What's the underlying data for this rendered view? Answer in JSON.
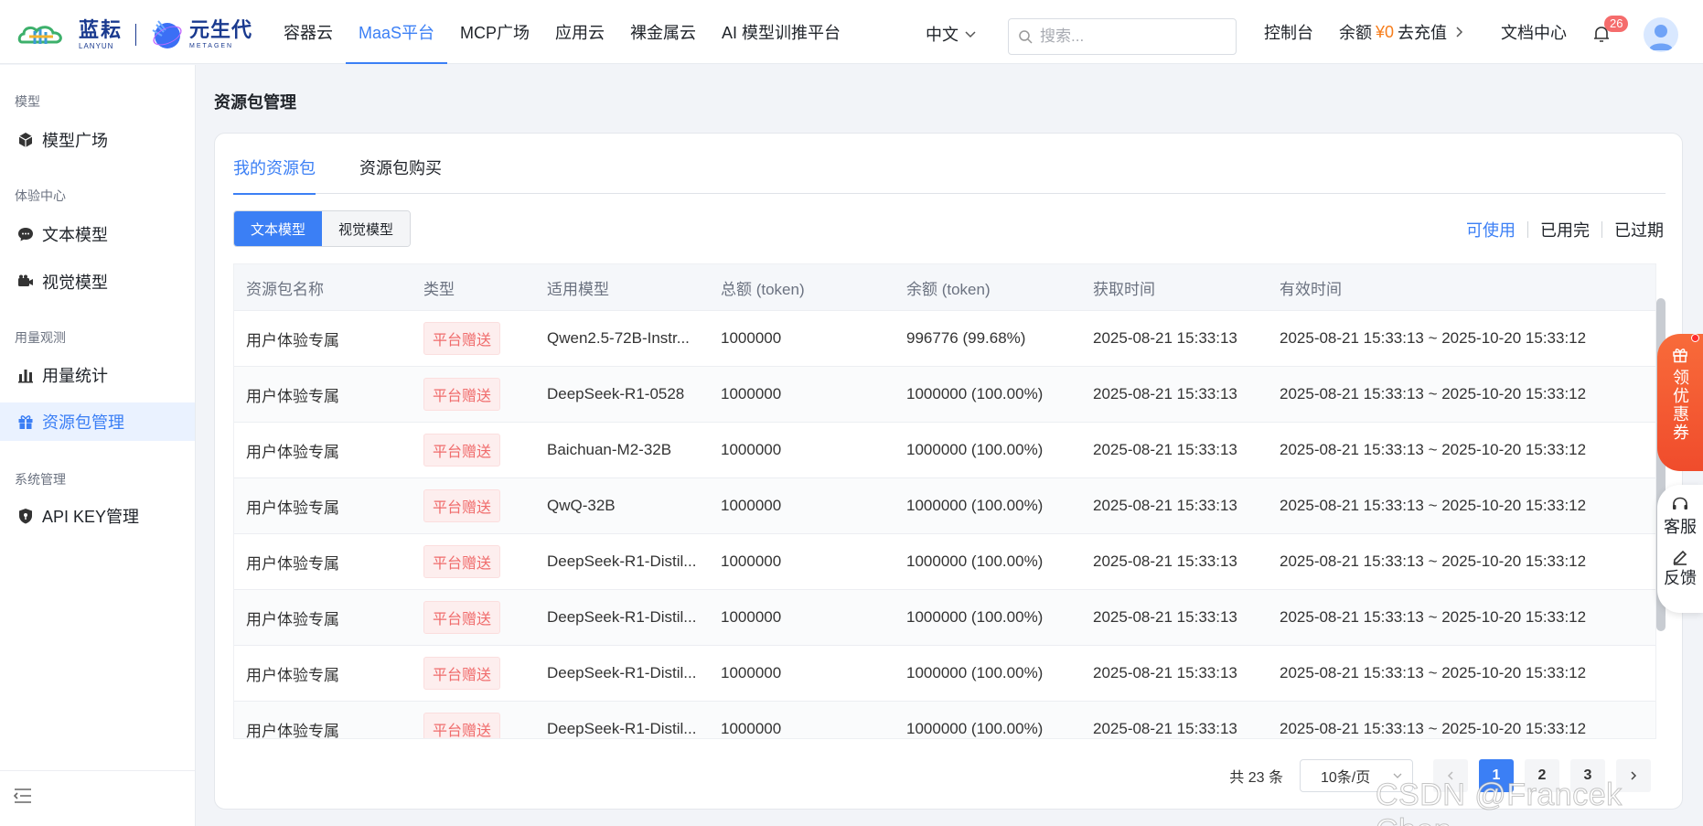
{
  "brand": {
    "logo1_cn": "蓝耘",
    "logo1_en": "LANYUN",
    "logo2_cn": "元生代",
    "logo2_en": "METAGEN"
  },
  "nav": {
    "items": [
      {
        "label": "容器云"
      },
      {
        "label": "MaaS平台",
        "active": true
      },
      {
        "label": "MCP广场"
      },
      {
        "label": "应用云"
      },
      {
        "label": "裸金属云"
      },
      {
        "label": "AI 模型训推平台"
      }
    ],
    "lang": "中文",
    "search_placeholder": "搜索...",
    "console": "控制台",
    "balance_label": "余额",
    "balance_amount": "¥0",
    "recharge": "去充值",
    "docs": "文档中心",
    "notifications": "26"
  },
  "sidebar": {
    "groups": [
      {
        "title": "模型",
        "items": [
          {
            "label": "模型广场",
            "icon": "cube-icon"
          }
        ]
      },
      {
        "title": "体验中心",
        "items": [
          {
            "label": "文本模型",
            "icon": "chat-bubble-icon"
          },
          {
            "label": "视觉模型",
            "icon": "camera-icon"
          }
        ]
      },
      {
        "title": "用量观测",
        "items": [
          {
            "label": "用量统计",
            "icon": "bar-chart-icon"
          },
          {
            "label": "资源包管理",
            "icon": "gift-icon",
            "active": true
          }
        ]
      },
      {
        "title": "系统管理",
        "items": [
          {
            "label": "API KEY管理",
            "icon": "shield-icon"
          }
        ]
      }
    ]
  },
  "page": {
    "title": "资源包管理",
    "tabs": [
      {
        "label": "我的资源包",
        "active": true
      },
      {
        "label": "资源包购买"
      }
    ],
    "segments": [
      {
        "label": "文本模型",
        "active": true
      },
      {
        "label": "视觉模型"
      }
    ],
    "filters": [
      {
        "label": "可使用",
        "active": true
      },
      {
        "label": "已用完"
      },
      {
        "label": "已过期"
      }
    ]
  },
  "table": {
    "headers": [
      "资源包名称",
      "类型",
      "适用模型",
      "总额 (token)",
      "余额 (token)",
      "获取时间",
      "有效时间"
    ],
    "rows": [
      {
        "name": "用户体验专属",
        "type": "平台赠送",
        "model": "Qwen2.5-72B-Instr...",
        "total": "1000000",
        "remain": "996776 (99.68%)",
        "acquired": "2025-08-21 15:33:13",
        "valid": "2025-08-21 15:33:13 ~ 2025-10-20 15:33:12"
      },
      {
        "name": "用户体验专属",
        "type": "平台赠送",
        "model": "DeepSeek-R1-0528",
        "total": "1000000",
        "remain": "1000000 (100.00%)",
        "acquired": "2025-08-21 15:33:13",
        "valid": "2025-08-21 15:33:13 ~ 2025-10-20 15:33:12"
      },
      {
        "name": "用户体验专属",
        "type": "平台赠送",
        "model": "Baichuan-M2-32B",
        "total": "1000000",
        "remain": "1000000 (100.00%)",
        "acquired": "2025-08-21 15:33:13",
        "valid": "2025-08-21 15:33:13 ~ 2025-10-20 15:33:12"
      },
      {
        "name": "用户体验专属",
        "type": "平台赠送",
        "model": "QwQ-32B",
        "total": "1000000",
        "remain": "1000000 (100.00%)",
        "acquired": "2025-08-21 15:33:13",
        "valid": "2025-08-21 15:33:13 ~ 2025-10-20 15:33:12"
      },
      {
        "name": "用户体验专属",
        "type": "平台赠送",
        "model": "DeepSeek-R1-Distil...",
        "total": "1000000",
        "remain": "1000000 (100.00%)",
        "acquired": "2025-08-21 15:33:13",
        "valid": "2025-08-21 15:33:13 ~ 2025-10-20 15:33:12"
      },
      {
        "name": "用户体验专属",
        "type": "平台赠送",
        "model": "DeepSeek-R1-Distil...",
        "total": "1000000",
        "remain": "1000000 (100.00%)",
        "acquired": "2025-08-21 15:33:13",
        "valid": "2025-08-21 15:33:13 ~ 2025-10-20 15:33:12"
      },
      {
        "name": "用户体验专属",
        "type": "平台赠送",
        "model": "DeepSeek-R1-Distil...",
        "total": "1000000",
        "remain": "1000000 (100.00%)",
        "acquired": "2025-08-21 15:33:13",
        "valid": "2025-08-21 15:33:13 ~ 2025-10-20 15:33:12"
      },
      {
        "name": "用户体验专属",
        "type": "平台赠送",
        "model": "DeepSeek-R1-Distil...",
        "total": "1000000",
        "remain": "1000000 (100.00%)",
        "acquired": "2025-08-21 15:33:13",
        "valid": "2025-08-21 15:33:13 ~ 2025-10-20 15:33:12"
      }
    ]
  },
  "pagination": {
    "total_text": "共 23 条",
    "page_size": "10条/页",
    "pages": [
      "1",
      "2",
      "3"
    ],
    "current": "1"
  },
  "float": {
    "promo": "领优惠券",
    "service": "客服",
    "feedback": "反馈"
  },
  "watermark": "CSDN @Francek Chen",
  "colors": {
    "accent": "#3b7ff5",
    "balance": "#f77d1b",
    "tag_text": "#f06b6b",
    "promo": "#f04c2c"
  }
}
